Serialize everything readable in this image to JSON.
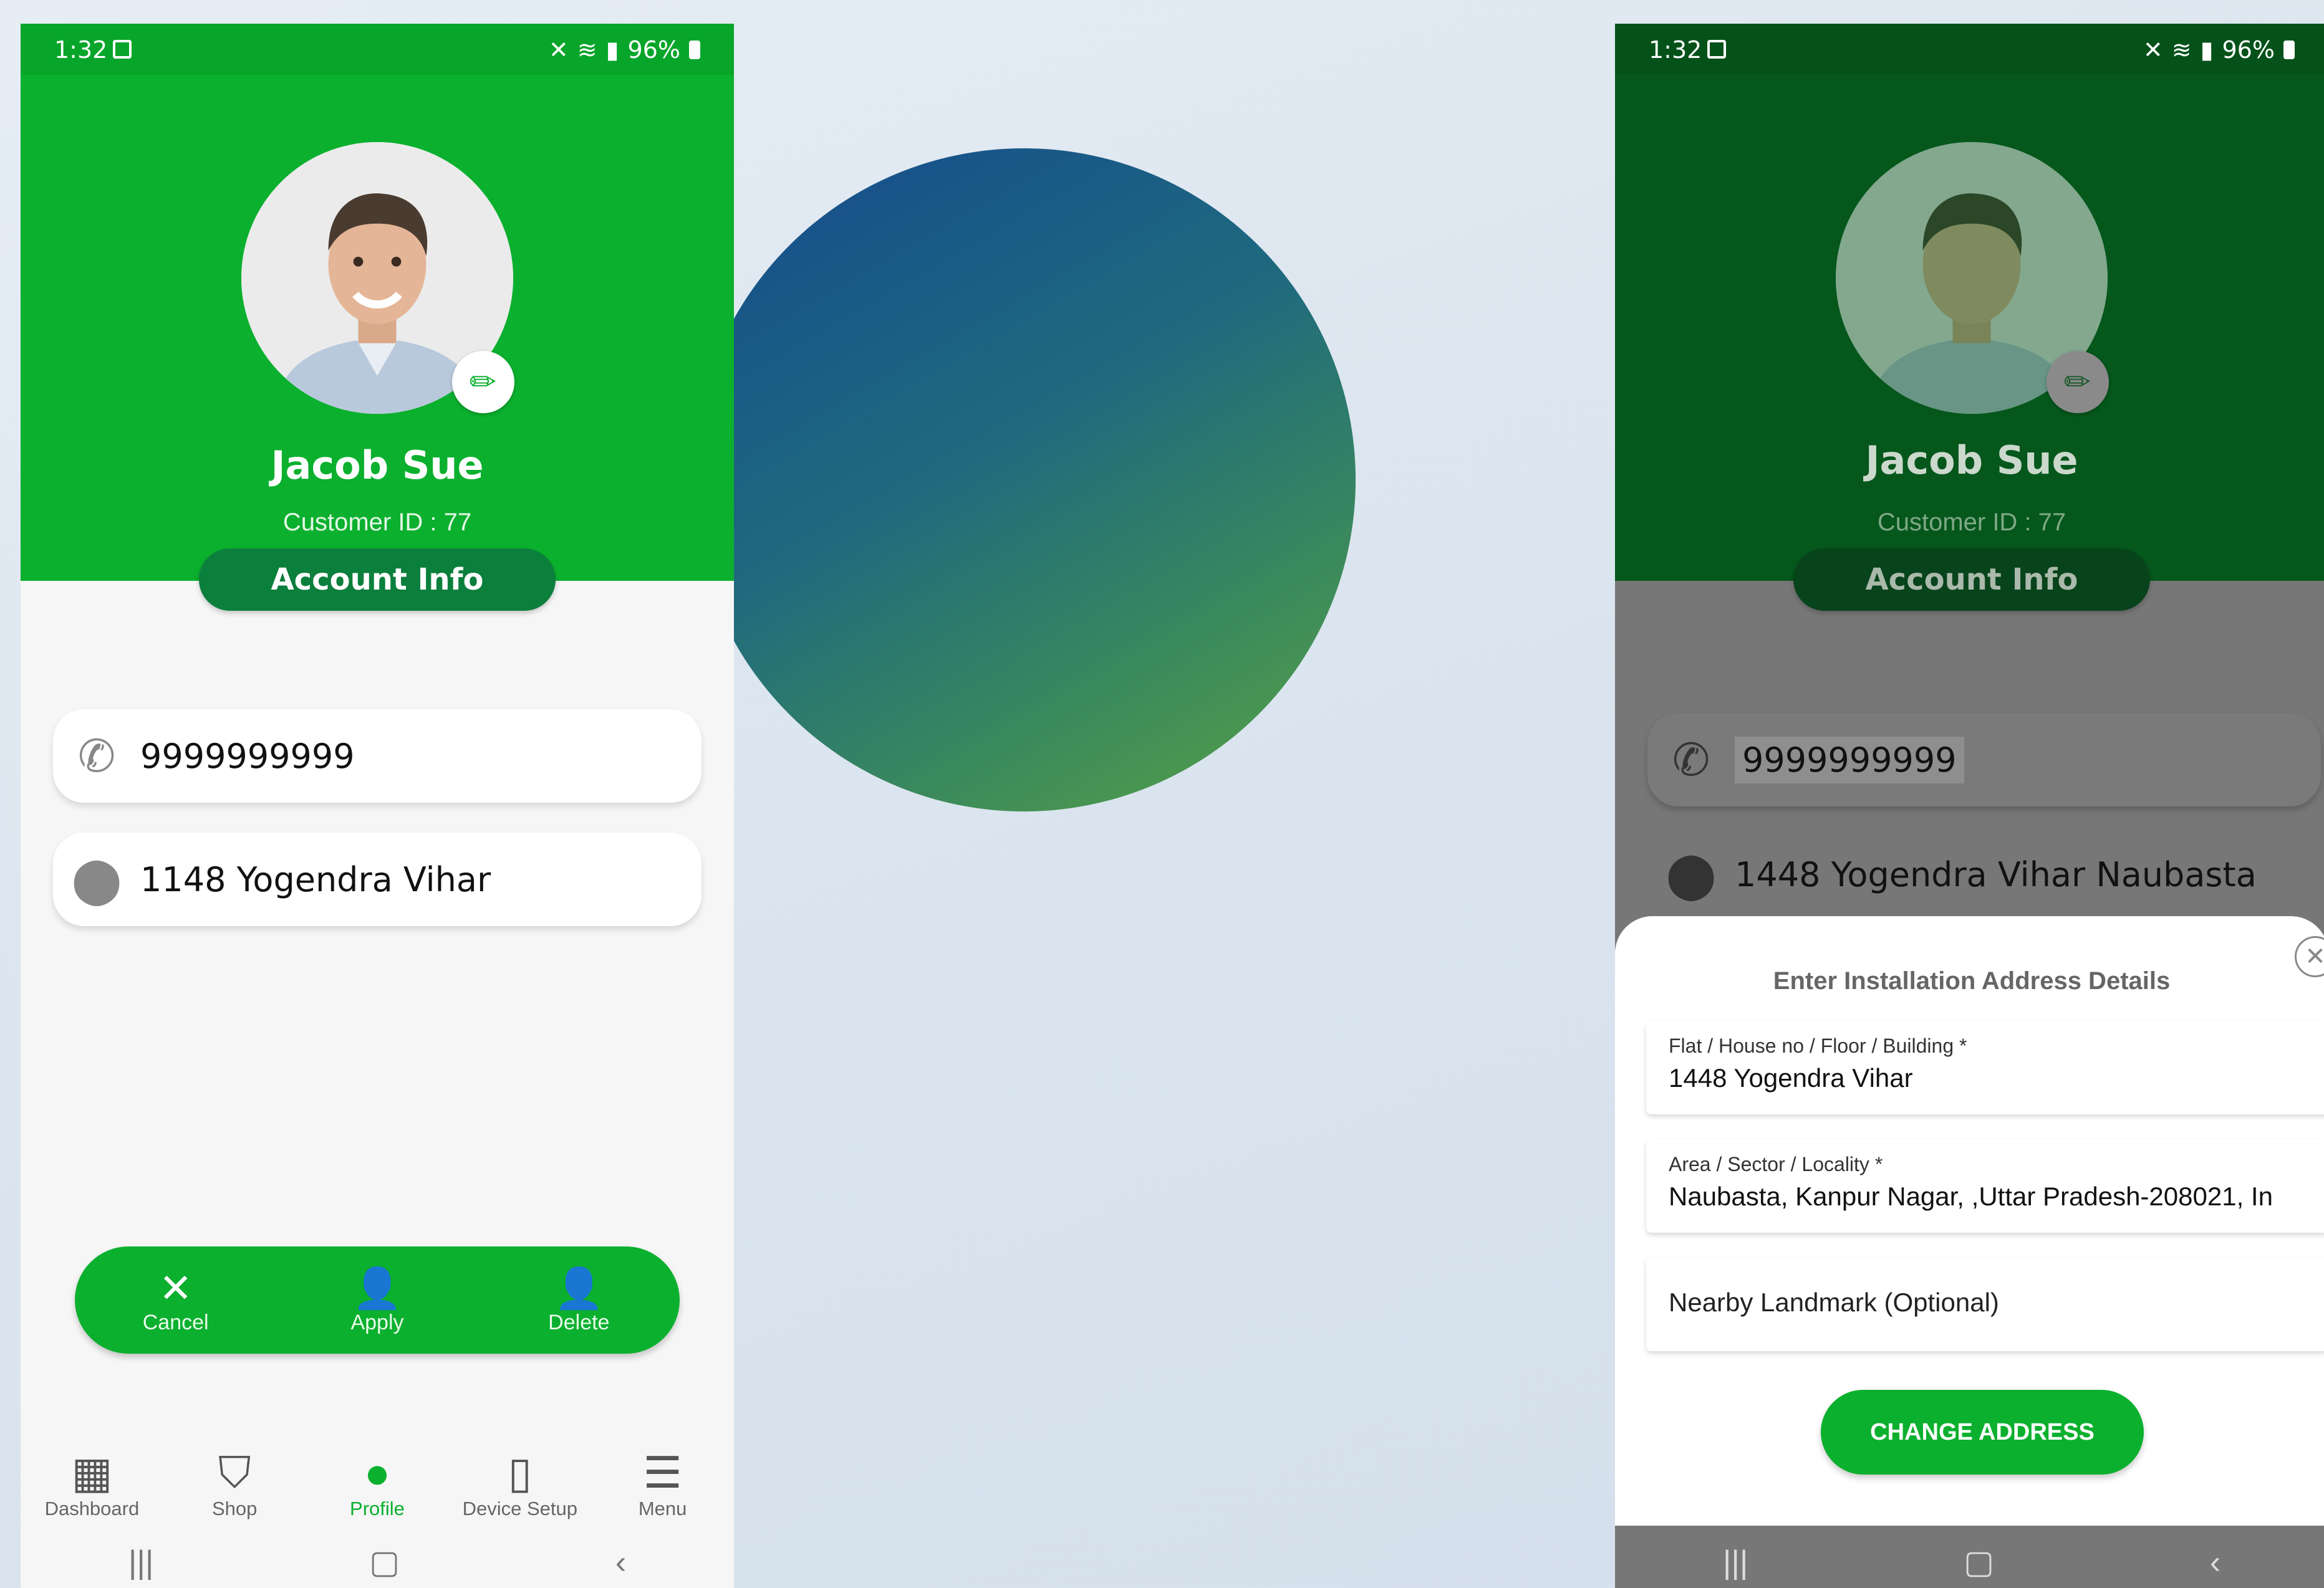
{
  "colors": {
    "brand_green": "#0bb02e",
    "dark_green": "#0b7f3c",
    "accent_blue": "#154a8e"
  },
  "status_bar": {
    "time": "1:32",
    "battery": "96%"
  },
  "profile": {
    "name": "Jacob Sue",
    "customer_id": "Customer ID : 77",
    "account_info_label": "Account Info"
  },
  "left_screen": {
    "phone": "9999999999",
    "address": "1148 Yogendra Vihar",
    "actions": [
      {
        "label": "Cancel",
        "icon": "close-icon"
      },
      {
        "label": "Apply",
        "icon": "user-check-icon"
      },
      {
        "label": "Delete",
        "icon": "user-delete-icon"
      }
    ]
  },
  "bottom_nav": [
    {
      "label": "Dashboard",
      "icon": "dashboard-icon"
    },
    {
      "label": "Shop",
      "icon": "shopping-bag-icon"
    },
    {
      "label": "Profile",
      "icon": "person-icon"
    },
    {
      "label": "Device Setup",
      "icon": "device-setup-icon"
    },
    {
      "label": "Menu",
      "icon": "menu-icon"
    }
  ],
  "right_screen": {
    "phone": "9999999999",
    "address": "1448 Yogendra Vihar Naubasta",
    "sheet": {
      "title": "Enter Installation Address Details",
      "flat_label": "Flat / House no / Floor / Building *",
      "flat_value": "1448 Yogendra Vihar",
      "area_label": "Area / Sector / Locality *",
      "area_value": "Naubasta, Kanpur Nagar, ,Uttar Pradesh-208021, In",
      "landmark_placeholder": "Nearby Landmark (Optional)",
      "submit_label": "CHANGE ADDRESS"
    }
  }
}
